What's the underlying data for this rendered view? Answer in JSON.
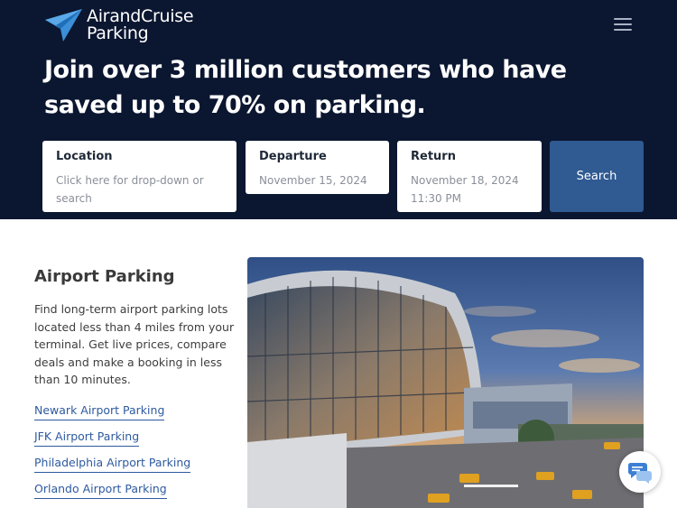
{
  "brand": {
    "name_line1": "AirandCruise",
    "name_line2": "Parking",
    "logo_icon": "paper-plane-icon",
    "primary_color": "#0b1630",
    "accent_color": "#2f5a92"
  },
  "header": {
    "menu_icon": "hamburger-menu-icon"
  },
  "hero": {
    "headline": "Join over 3 million customers who have saved up to 70% on parking."
  },
  "search_form": {
    "location": {
      "label": "Location",
      "placeholder": "Click here for drop-down or search"
    },
    "departure": {
      "label": "Departure",
      "value": "November 15, 2024"
    },
    "return": {
      "label": "Return",
      "value": "November 18, 2024 11:30 PM"
    },
    "search_label": "Search"
  },
  "airport_section": {
    "title": "Airport Parking",
    "description": "Find long-term airport parking lots located less than 4 miles from your terminal. Get live prices, compare deals and make a booking in less than 10 minutes.",
    "links": [
      "Newark Airport Parking",
      "JFK Airport Parking",
      "Philadelphia Airport Parking",
      "Orlando Airport Parking"
    ],
    "image_subject": "airport-terminal-photo"
  },
  "chat": {
    "icon": "chat-bubbles-icon"
  }
}
